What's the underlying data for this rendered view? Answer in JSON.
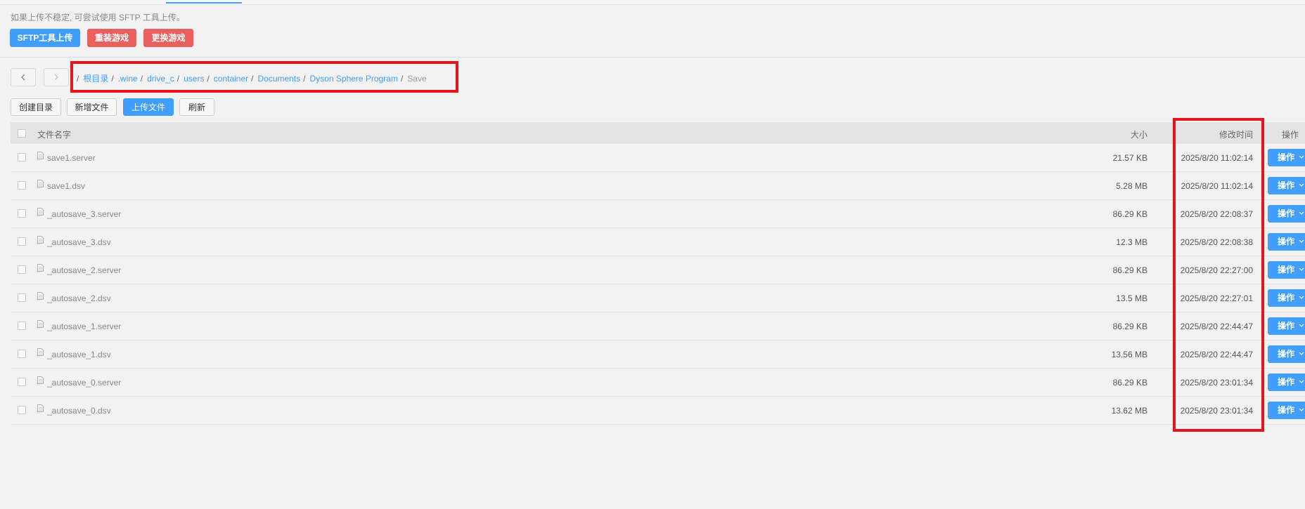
{
  "notice": "如果上传不稳定, 可尝试使用 SFTP 工具上传。",
  "actions": {
    "sftp": "SFTP工具上传",
    "reinstall": "重装游戏",
    "change": "更换游戏"
  },
  "breadcrumb": {
    "separator": "/",
    "items": [
      "根目录",
      ".wine",
      "drive_c",
      "users",
      "container",
      "Documents",
      "Dyson Sphere Program"
    ],
    "current": "Save"
  },
  "toolbar": {
    "mkdir": "创建目录",
    "new_file": "新增文件",
    "upload": "上传文件",
    "refresh": "刷新"
  },
  "table": {
    "columns": {
      "name": "文件名字",
      "size": "大小",
      "modified": "修改时间",
      "action": "操作"
    },
    "action_label": "操作",
    "rows": [
      {
        "name": "save1.server",
        "size": "21.57 KB",
        "modified": "2025/8/20 11:02:14"
      },
      {
        "name": "save1.dsv",
        "size": "5.28 MB",
        "modified": "2025/8/20 11:02:14"
      },
      {
        "name": "_autosave_3.server",
        "size": "86.29 KB",
        "modified": "2025/8/20 22:08:37"
      },
      {
        "name": "_autosave_3.dsv",
        "size": "12.3 MB",
        "modified": "2025/8/20 22:08:38"
      },
      {
        "name": "_autosave_2.server",
        "size": "86.29 KB",
        "modified": "2025/8/20 22:27:00"
      },
      {
        "name": "_autosave_2.dsv",
        "size": "13.5 MB",
        "modified": "2025/8/20 22:27:01"
      },
      {
        "name": "_autosave_1.server",
        "size": "86.29 KB",
        "modified": "2025/8/20 22:44:47"
      },
      {
        "name": "_autosave_1.dsv",
        "size": "13.56 MB",
        "modified": "2025/8/20 22:44:47"
      },
      {
        "name": "_autosave_0.server",
        "size": "86.29 KB",
        "modified": "2025/8/20 23:01:34"
      },
      {
        "name": "_autosave_0.dsv",
        "size": "13.62 MB",
        "modified": "2025/8/20 23:01:34"
      }
    ]
  },
  "colors": {
    "primary": "#409eff",
    "danger": "#e9605f",
    "highlight": "#e8131b"
  }
}
